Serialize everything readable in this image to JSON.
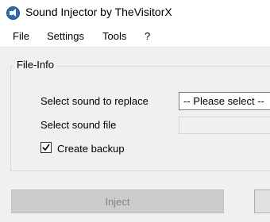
{
  "window": {
    "title": "Sound Injector by TheVisitorX"
  },
  "menu": {
    "items": [
      "File",
      "Settings",
      "Tools",
      "?"
    ]
  },
  "file_info": {
    "group_label": "File-Info",
    "replace_label": "Select sound to replace",
    "replace_select_value": "-- Please select --",
    "sound_file_label": "Select sound file",
    "sound_file_value": "",
    "backup_label": "Create backup",
    "backup_checked": true
  },
  "buttons": {
    "inject_label": "Inject",
    "inject_enabled": false
  },
  "colors": {
    "icon_blue": "#2a6fb0",
    "disabled_text": "#838383"
  }
}
